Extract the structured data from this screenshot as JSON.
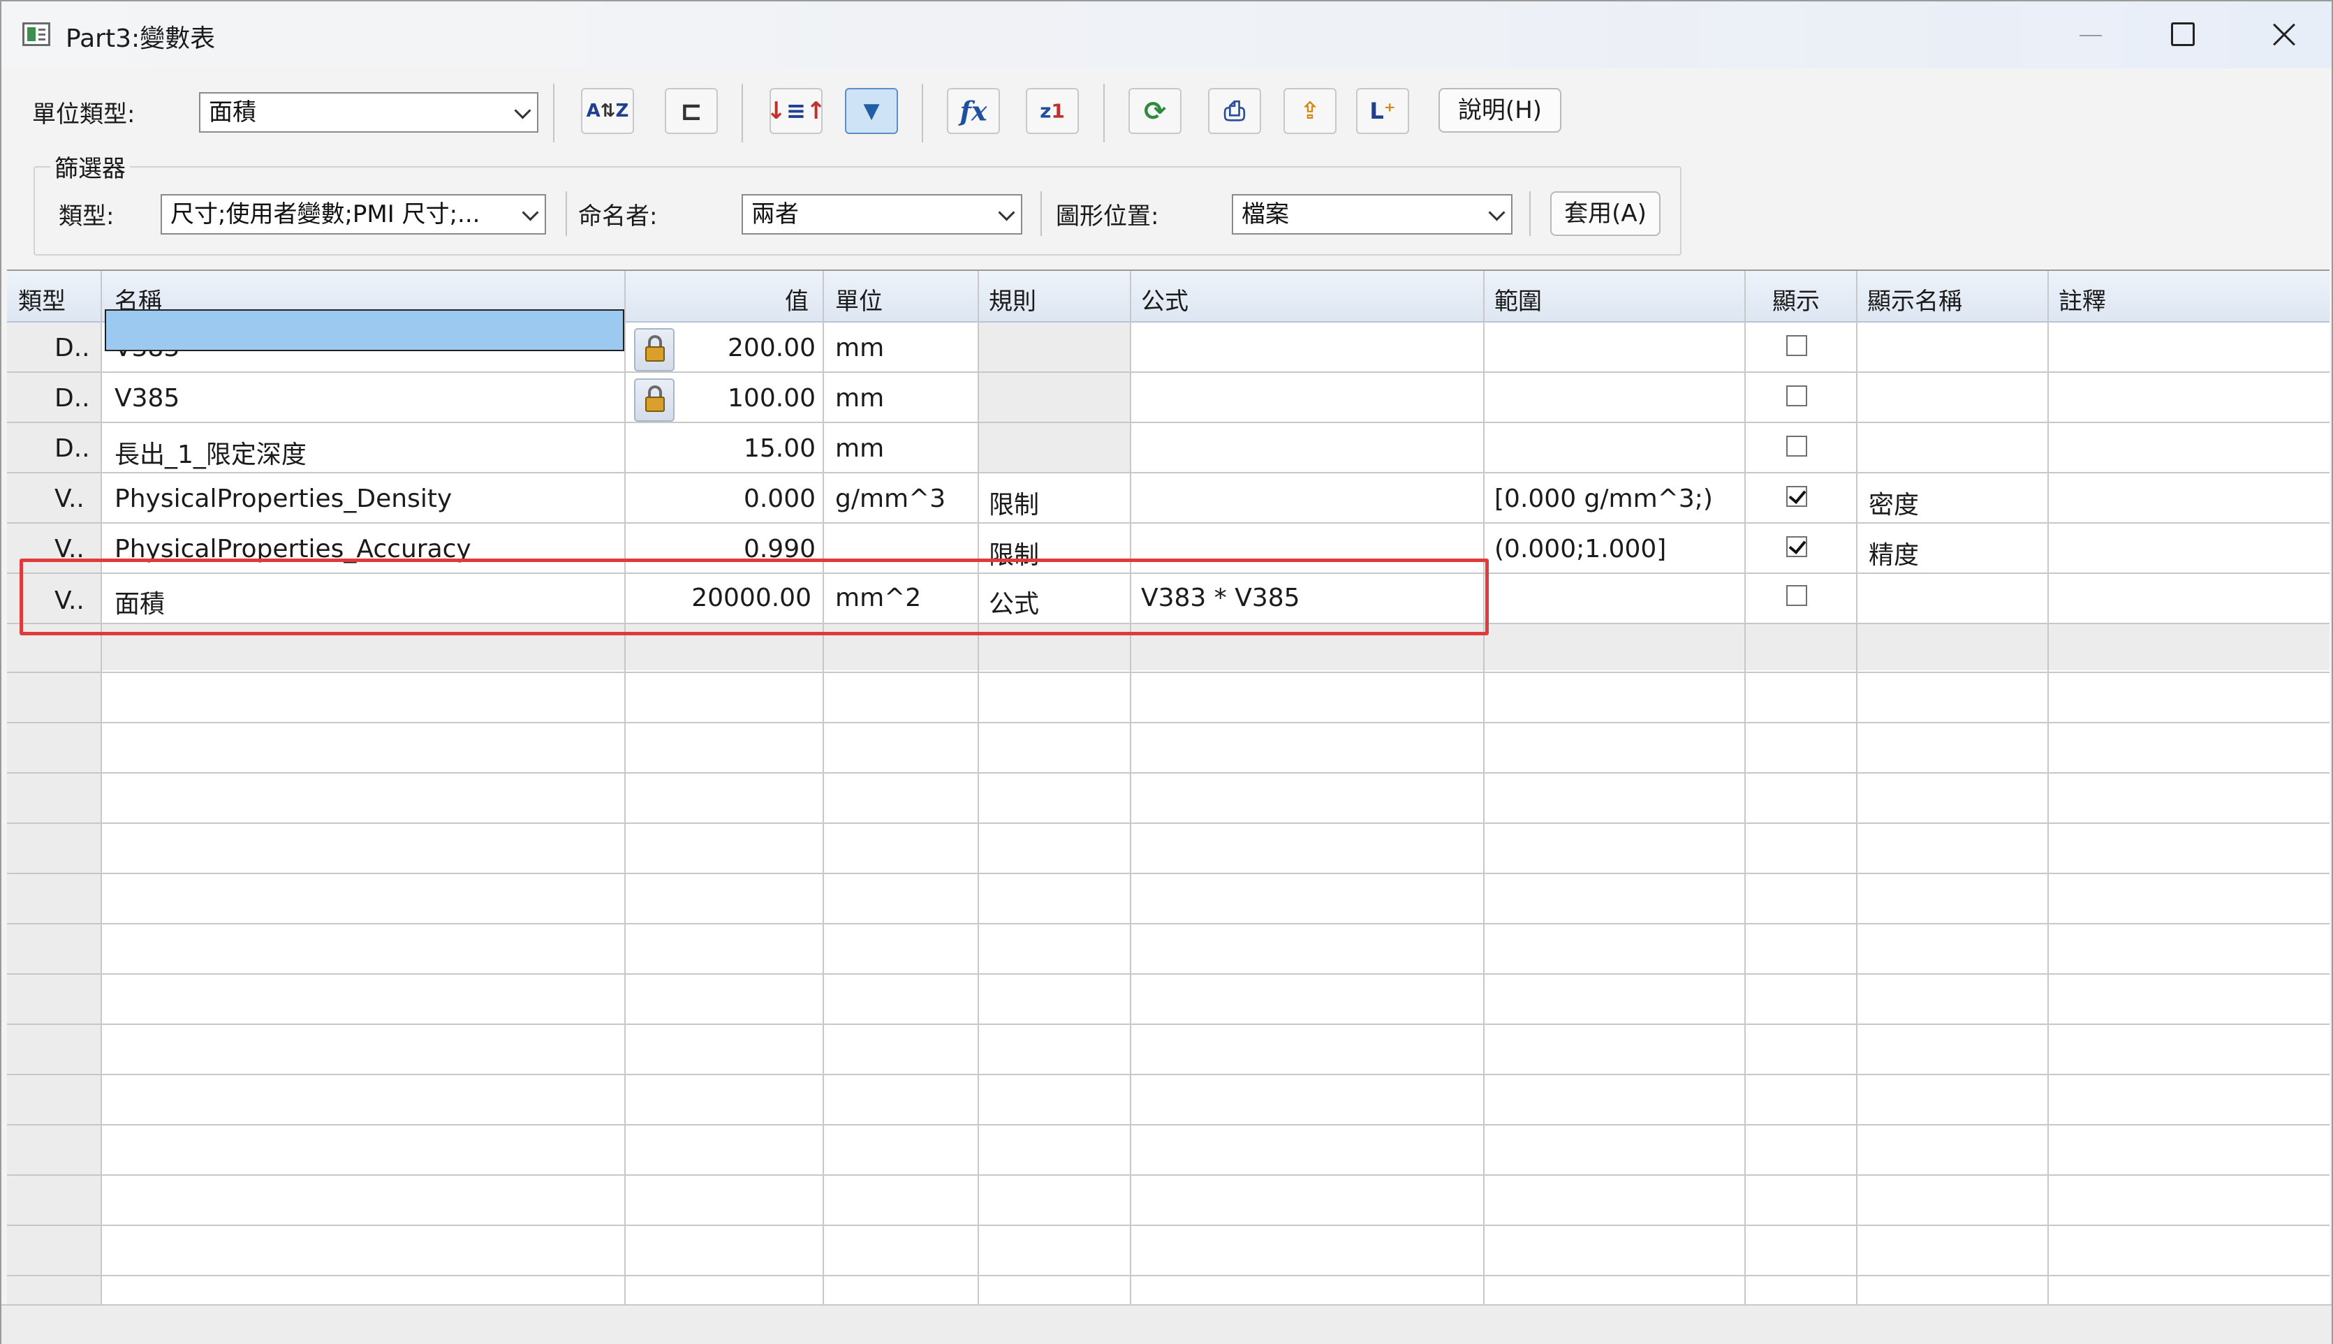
{
  "window": {
    "title": "Part3:變數表"
  },
  "toolbar": {
    "unit_type_label": "單位類型:",
    "unit_type_value": "面積",
    "buttons": [
      {
        "icon": "sort-az-icon",
        "glyph": "A↓Z"
      },
      {
        "icon": "tree-view-icon",
        "glyph": "⊏"
      },
      {
        "icon": "sort-order-icon",
        "glyph": "↓↑"
      },
      {
        "icon": "filter-icon",
        "glyph": "▼"
      },
      {
        "icon": "formula-fx-icon",
        "glyph": "fx"
      },
      {
        "icon": "function-wizard-icon",
        "glyph": "z1"
      },
      {
        "icon": "refresh-icon",
        "glyph": "⟳"
      },
      {
        "icon": "print-icon",
        "glyph": "⎙"
      },
      {
        "icon": "export-icon",
        "glyph": "⇪"
      },
      {
        "icon": "add-variable-icon",
        "glyph": "L⁺"
      }
    ],
    "help_label": "說明(H)"
  },
  "filter": {
    "group_label": "篩選器",
    "type_label": "類型:",
    "type_value": "尺寸;使用者變數;PMI 尺寸;...",
    "named_by_label": "命名者:",
    "named_by_value": "兩者",
    "graphic_location_label": "圖形位置:",
    "graphic_location_value": "檔案",
    "apply_label": "套用(A)"
  },
  "grid": {
    "headers": [
      "類型",
      "名稱",
      "值",
      "單位",
      "規則",
      "公式",
      "範圍",
      "顯示",
      "顯示名稱",
      "註釋"
    ],
    "rows": [
      {
        "type": "D..",
        "name": "V383",
        "locked": true,
        "value": "200.00",
        "unit": "mm",
        "rule": "",
        "formula": "",
        "range": "",
        "show": false,
        "display_name": "",
        "note": ""
      },
      {
        "type": "D..",
        "name": "V385",
        "locked": true,
        "value": "100.00",
        "unit": "mm",
        "rule": "",
        "formula": "",
        "range": "",
        "show": false,
        "display_name": "",
        "note": ""
      },
      {
        "type": "D..",
        "name": "長出_1_限定深度",
        "locked": false,
        "value": "15.00",
        "unit": "mm",
        "rule": "",
        "formula": "",
        "range": "",
        "show": false,
        "display_name": "",
        "note": ""
      },
      {
        "type": "V..",
        "name": "PhysicalProperties_Density",
        "locked": false,
        "value": "0.000",
        "unit": "g/mm^3",
        "rule": "限制",
        "formula": "",
        "range": "[0.000 g/mm^3;)",
        "show": true,
        "display_name": "密度",
        "note": ""
      },
      {
        "type": "V..",
        "name": "PhysicalProperties_Accuracy",
        "locked": false,
        "value": "0.990",
        "unit": "",
        "rule": "限制",
        "formula": "",
        "range": "(0.000;1.000]",
        "show": true,
        "display_name": "精度",
        "note": ""
      },
      {
        "type": "V..",
        "name": "面積",
        "locked": false,
        "value": "20000.00",
        "unit": "mm^2",
        "rule": "公式",
        "formula": "V383 * V385",
        "range": "",
        "show": false,
        "display_name": "",
        "note": ""
      }
    ]
  }
}
